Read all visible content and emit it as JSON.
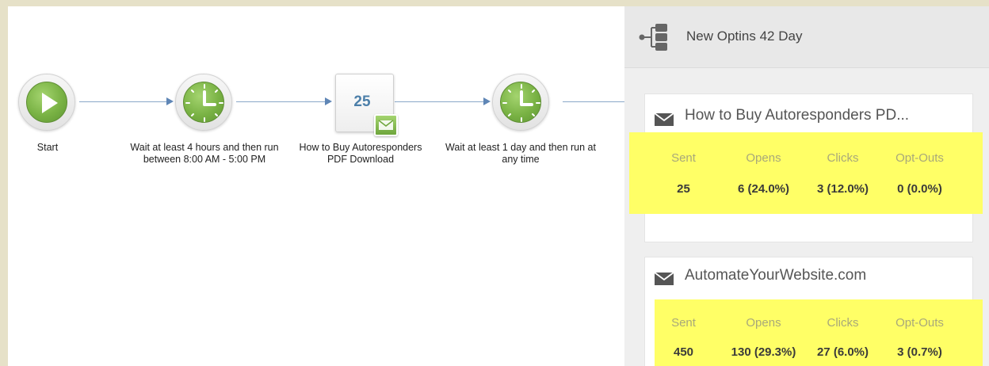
{
  "workflow": {
    "nodes": [
      {
        "label": "Start"
      },
      {
        "label": "Wait at least 4 hours and then run between 8:00 AM - 5:00 PM"
      },
      {
        "label": "How to Buy Autoresponders PDF Download",
        "count": "25"
      },
      {
        "label": "Wait at least 1 day and then run at any time"
      }
    ]
  },
  "panel": {
    "title": "New Optins 42 Day",
    "cards": [
      {
        "title": "How to Buy Autoresponders PD...",
        "stats": {
          "headers": [
            "Sent",
            "Opens",
            "Clicks",
            "Opt-Outs"
          ],
          "values": [
            "25",
            "6 (24.0%)",
            "3 (12.0%)",
            "0 (0.0%)"
          ]
        }
      },
      {
        "title": "AutomateYourWebsite.com",
        "stats": {
          "headers": [
            "Sent",
            "Opens",
            "Clicks",
            "Opt-Outs"
          ],
          "values": [
            "450",
            "130 (29.3%)",
            "27 (6.0%)",
            "3 (0.7%)"
          ]
        }
      }
    ]
  },
  "colors": {
    "highlight": "#ffff66",
    "node_green": "#79b244",
    "connector": "#5f86b6",
    "count_blue": "#4c7fa9"
  }
}
